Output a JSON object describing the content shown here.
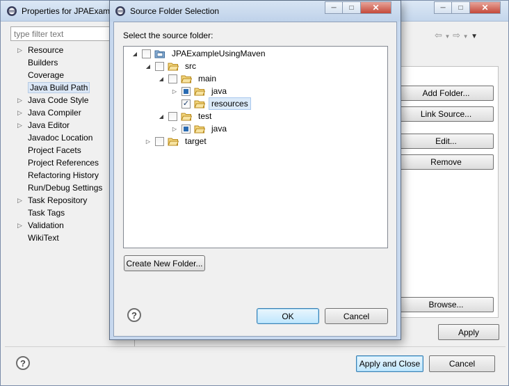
{
  "properties_window": {
    "title": "Properties for JPAExamp",
    "filter_placeholder": "type filter text",
    "nav_items": [
      {
        "label": "Resource",
        "expandable": true
      },
      {
        "label": "Builders",
        "expandable": false
      },
      {
        "label": "Coverage",
        "expandable": false
      },
      {
        "label": "Java Build Path",
        "expandable": false,
        "selected": true
      },
      {
        "label": "Java Code Style",
        "expandable": true
      },
      {
        "label": "Java Compiler",
        "expandable": true
      },
      {
        "label": "Java Editor",
        "expandable": true
      },
      {
        "label": "Javadoc Location",
        "expandable": false
      },
      {
        "label": "Project Facets",
        "expandable": false
      },
      {
        "label": "Project References",
        "expandable": false
      },
      {
        "label": "Refactoring History",
        "expandable": false
      },
      {
        "label": "Run/Debug Settings",
        "expandable": false
      },
      {
        "label": "Task Repository",
        "expandable": true
      },
      {
        "label": "Task Tags",
        "expandable": false
      },
      {
        "label": "Validation",
        "expandable": true
      },
      {
        "label": "WikiText",
        "expandable": false
      }
    ],
    "buttons": {
      "add_folder": "Add Folder...",
      "link_source": "Link Source...",
      "edit": "Edit...",
      "remove": "Remove",
      "browse": "Browse...",
      "apply": "Apply",
      "apply_and_close": "Apply and Close",
      "cancel": "Cancel"
    }
  },
  "dialog": {
    "title": "Source Folder Selection",
    "prompt": "Select the source folder:",
    "tree": [
      {
        "label": "JPAExampleUsingMaven",
        "depth": 0,
        "twisty": "expanded",
        "check": "unchecked",
        "icon": "project-icon"
      },
      {
        "label": "src",
        "depth": 1,
        "twisty": "expanded",
        "check": "unchecked",
        "icon": "folder-icon"
      },
      {
        "label": "main",
        "depth": 2,
        "twisty": "expanded",
        "check": "unchecked",
        "icon": "folder-icon"
      },
      {
        "label": "java",
        "depth": 3,
        "twisty": "collapsed",
        "check": "partial",
        "icon": "folder-icon"
      },
      {
        "label": "resources",
        "depth": 3,
        "twisty": "none",
        "check": "checked",
        "icon": "folder-icon",
        "selected": true
      },
      {
        "label": "test",
        "depth": 2,
        "twisty": "expanded",
        "check": "unchecked",
        "icon": "folder-icon"
      },
      {
        "label": "java",
        "depth": 3,
        "twisty": "collapsed",
        "check": "partial",
        "icon": "folder-icon"
      },
      {
        "label": "target",
        "depth": 1,
        "twisty": "collapsed",
        "check": "unchecked",
        "icon": "folder-icon"
      }
    ],
    "buttons": {
      "create_new_folder": "Create New Folder...",
      "ok": "OK",
      "cancel": "Cancel"
    }
  },
  "help_symbol": "?",
  "colors": {
    "accent": "#3c7fb1",
    "title_bar": "#c7d8ee",
    "folder": "#e8b64a"
  }
}
